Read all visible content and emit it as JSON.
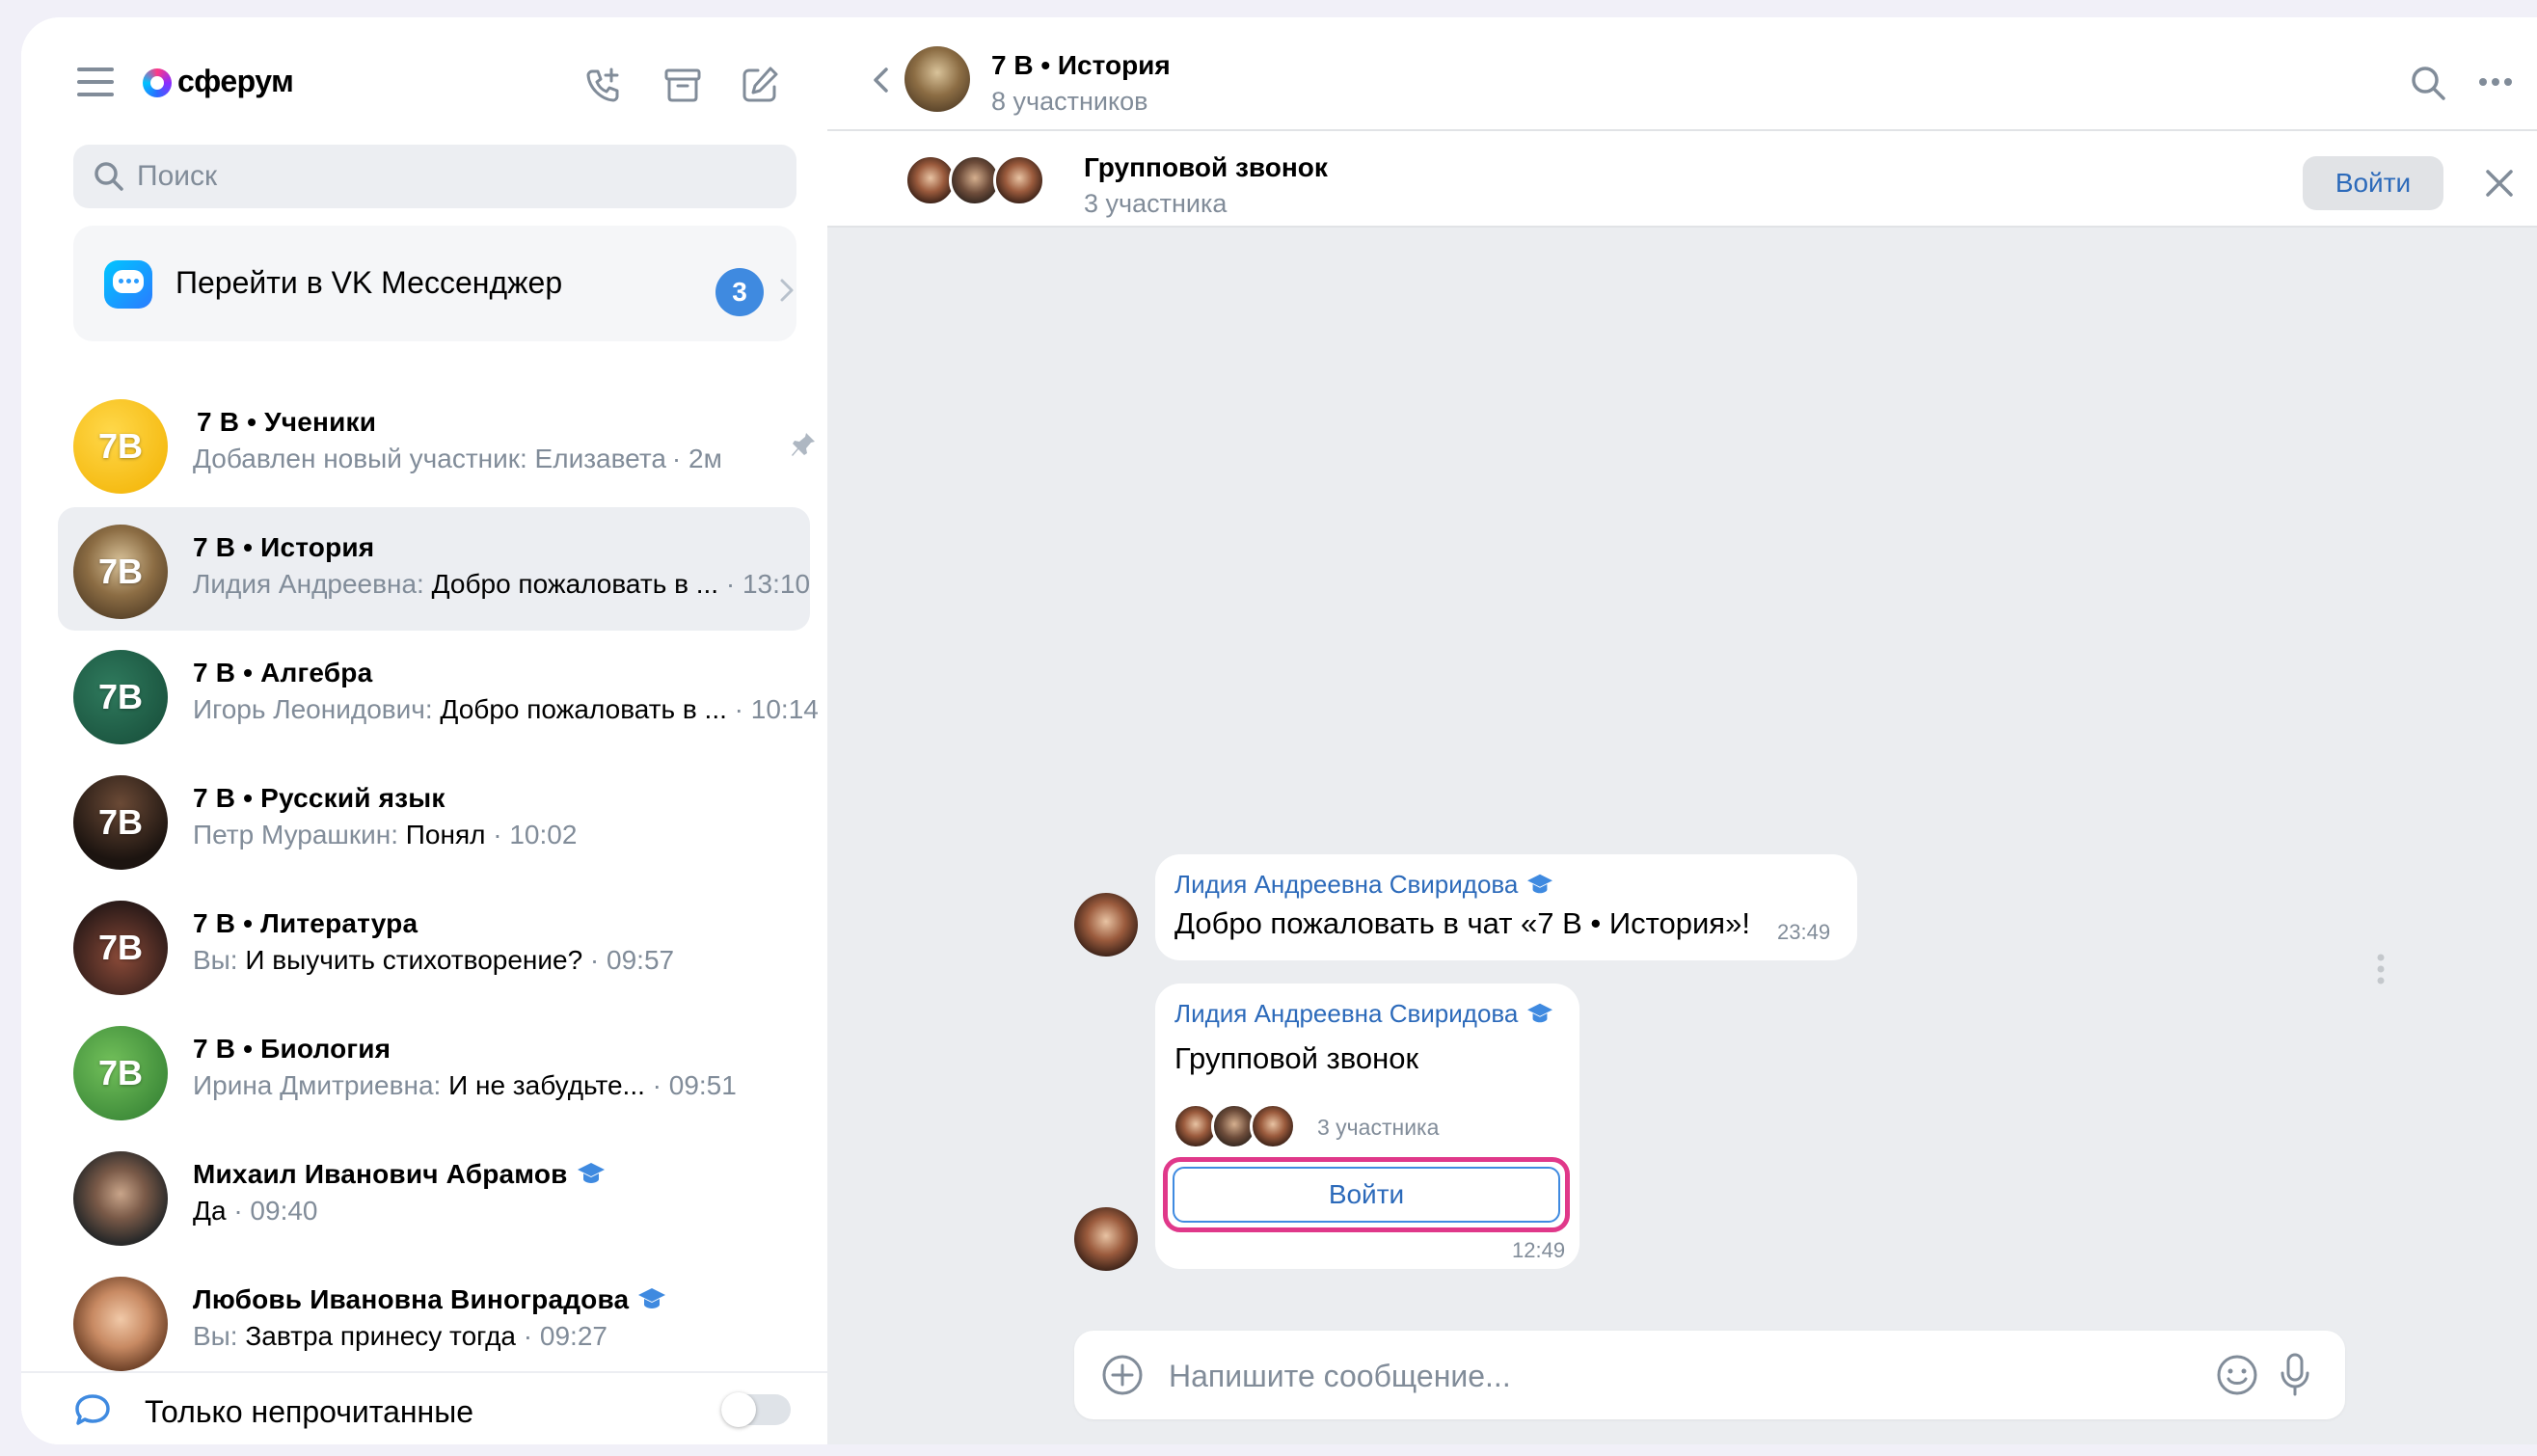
{
  "brand": {
    "name": "сферум"
  },
  "search": {
    "placeholder": "Поиск"
  },
  "vk_banner": {
    "label": "Перейти в VK Мессенджер",
    "badge": "3"
  },
  "chats": [
    {
      "title": "7 В • Ученики",
      "sender": "",
      "message": "Добавлен новый участник: Елизавета",
      "time": "· 2м",
      "avatar_text": "7В",
      "pinned": true
    },
    {
      "title": "7 В • История",
      "sender": "Лидия Андреевна:",
      "message": " Добро пожаловать в ...",
      "time": " · 13:10",
      "avatar_text": "7В",
      "selected": true
    },
    {
      "title": "7 В • Алгебра",
      "sender": "Игорь Леонидович:",
      "message": " Добро пожаловать в ...",
      "time": " · 10:14",
      "avatar_text": "7В"
    },
    {
      "title": "7 В • Русский язык",
      "sender": "Петр Мурашкин:",
      "message": " Понял",
      "time": " · 10:02",
      "avatar_text": "7В"
    },
    {
      "title": "7 В • Литература",
      "sender": "Вы:",
      "message": " И выучить стихотворение?",
      "time": " · 09:57",
      "avatar_text": "7В"
    },
    {
      "title": "7 В • Биология",
      "sender": "Ирина Дмитриевна:",
      "message": " И не забудьте...",
      "time": " · 09:51",
      "avatar_text": "7В"
    },
    {
      "title": "Михаил Иванович Абрамов",
      "sender": "",
      "message": "Да",
      "time": " · 09:40",
      "verified": true
    },
    {
      "title": "Любовь Ивановна Виноградова",
      "sender": "Вы:",
      "message": " Завтра принесу тогда",
      "time": " · 09:27",
      "verified": true
    }
  ],
  "filter": {
    "label": "Только непрочитанные",
    "enabled": false
  },
  "chat_header": {
    "title": "7 В • История",
    "subtitle": "8 участников"
  },
  "call_bar": {
    "title": "Групповой звонок",
    "subtitle": "3 участника",
    "join_label": "Войти"
  },
  "messages": [
    {
      "sender": "Лидия Андреевна Свиридова",
      "text": "Добро пожаловать в чат «7 В • История»!",
      "time": "23:49"
    },
    {
      "sender": "Лидия Андреевна Свиридова",
      "call_title": "Групповой звонок",
      "call_participants": "3 участника",
      "join_label": "Войти",
      "time": "12:49"
    }
  ],
  "composer": {
    "placeholder": "Напишите сообщение..."
  },
  "colors": {
    "accent": "#3f8ae0",
    "link": "#2c6aba",
    "highlight": "#e0388a",
    "secondary_text": "#818c99"
  },
  "icons": [
    "menu-icon",
    "call-add-icon",
    "archive-icon",
    "compose-icon",
    "search-icon",
    "chevron-right-icon",
    "pin-icon",
    "verified-icon",
    "chat-bubble-icon",
    "back-icon",
    "more-icon",
    "close-icon",
    "add-icon",
    "emoji-icon",
    "mic-icon"
  ]
}
